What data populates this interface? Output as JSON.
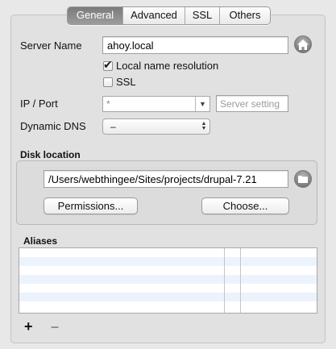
{
  "tabs": [
    {
      "label": "General",
      "active": true
    },
    {
      "label": "Advanced",
      "active": false
    },
    {
      "label": "SSL",
      "active": false
    },
    {
      "label": "Others",
      "active": false
    }
  ],
  "server_name": {
    "label": "Server Name",
    "value": "ahoy.local"
  },
  "checkboxes": {
    "local_name_resolution": {
      "label": "Local name resolution",
      "checked": true
    },
    "ssl": {
      "label": "SSL",
      "checked": false
    }
  },
  "ip_port": {
    "label": "IP / Port",
    "ip_value": "*",
    "port_placeholder": "Server setting"
  },
  "dynamic_dns": {
    "label": "Dynamic DNS",
    "value": "–"
  },
  "disk_location": {
    "title": "Disk location",
    "path": "/Users/webthingee/Sites/projects/drupal-7.21",
    "permissions_button": "Permissions...",
    "choose_button": "Choose..."
  },
  "aliases": {
    "title": "Aliases",
    "rows": 7
  },
  "toolbar": {
    "add": "+",
    "remove": "–"
  },
  "colors": {
    "active_tab": "#8a8a8a",
    "pane": "#e1e1e1",
    "alt_row": "#edf3fd"
  }
}
